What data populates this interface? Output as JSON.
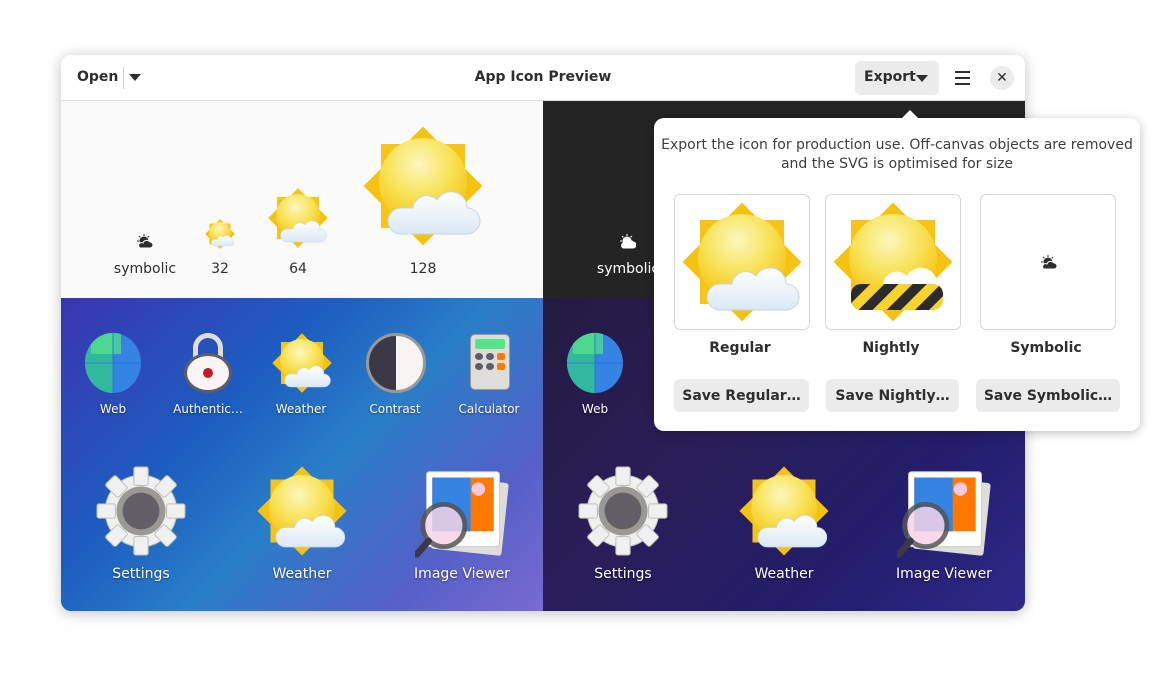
{
  "header": {
    "open_label": "Open",
    "title": "App Icon Preview",
    "export_label": "Export",
    "menu_icon": "hamburger-icon",
    "close_icon": "close-icon"
  },
  "preview_sizes": [
    {
      "label": "symbolic"
    },
    {
      "label": "32"
    },
    {
      "label": "64"
    },
    {
      "label": "128"
    }
  ],
  "dark_preview": {
    "symbolic_label": "symbolic"
  },
  "light_grid": {
    "small": [
      "Web",
      "Authentic…",
      "Weather",
      "Contrast",
      "Calculator"
    ],
    "large": [
      "Settings",
      "Weather",
      "Image Viewer"
    ]
  },
  "dark_grid": {
    "small": [
      "Web"
    ],
    "large": [
      "Settings",
      "Weather",
      "Image Viewer"
    ]
  },
  "export_popover": {
    "description_line1": "Export the icon for production use. Off-canvas objects are removed",
    "description_line2": "and the SVG is optimised for size",
    "variants": [
      {
        "label": "Regular",
        "button": "Save Regular…"
      },
      {
        "label": "Nightly",
        "button": "Save Nightly…"
      },
      {
        "label": "Symbolic",
        "button": "Save Symbolic…"
      }
    ]
  },
  "colors": {
    "sun": "#f6d32d",
    "light_bg": "#fafafa",
    "dark_bg": "#242424",
    "button_bg": "#ebebeb"
  }
}
